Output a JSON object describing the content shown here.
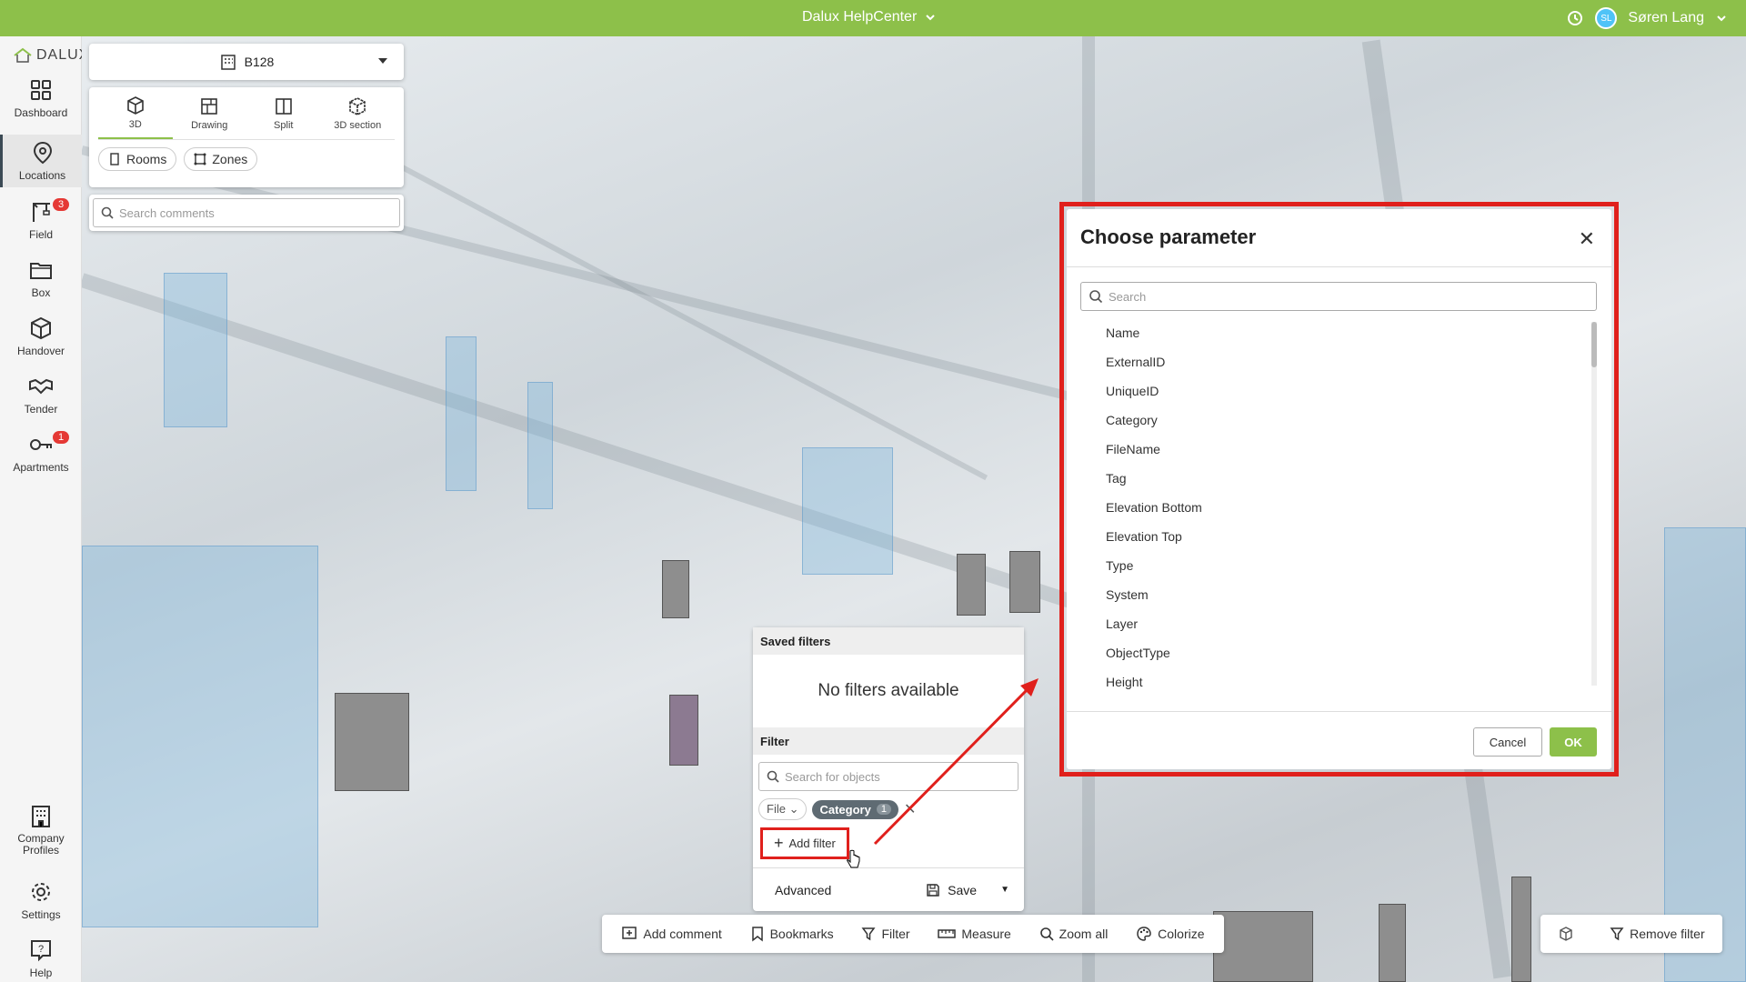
{
  "topbar": {
    "center_title": "Dalux HelpCenter",
    "user_initials": "SL",
    "user_name": "Søren Lang"
  },
  "sidebar": {
    "logo_text": "DALUX",
    "items": [
      {
        "label": "Dashboard",
        "icon": "grid-icon"
      },
      {
        "label": "Locations",
        "icon": "location-pin-icon"
      },
      {
        "label": "Field",
        "icon": "crane-icon",
        "badge": "3"
      },
      {
        "label": "Box",
        "icon": "folder-icon"
      },
      {
        "label": "Handover",
        "icon": "cube-icon"
      },
      {
        "label": "Tender",
        "icon": "handshake-icon"
      },
      {
        "label": "Apartments",
        "icon": "key-icon",
        "badge": "1"
      },
      {
        "label": "Company Profiles",
        "icon": "building-icon"
      },
      {
        "label": "Settings",
        "icon": "gear-icon"
      },
      {
        "label": "Help",
        "icon": "help-icon"
      }
    ]
  },
  "project": {
    "name": "B128"
  },
  "view_tabs": [
    {
      "label": "3D"
    },
    {
      "label": "Drawing"
    },
    {
      "label": "Split"
    },
    {
      "label": "3D section"
    }
  ],
  "chips": {
    "rooms": "Rooms",
    "zones": "Zones"
  },
  "search_comments": {
    "placeholder": "Search comments"
  },
  "filter_popup": {
    "saved_filters_title": "Saved filters",
    "empty_text": "No filters available",
    "filter_title": "Filter",
    "search_placeholder": "Search for objects",
    "file_chip": "File",
    "category_chip": "Category",
    "category_count": "1",
    "add_filter": "Add filter",
    "advanced": "Advanced",
    "save": "Save"
  },
  "toolbar": {
    "add_comment": "Add comment",
    "bookmarks": "Bookmarks",
    "filter": "Filter",
    "measure": "Measure",
    "zoom_all": "Zoom all",
    "colorize": "Colorize",
    "remove_filter": "Remove filter"
  },
  "dialog": {
    "title": "Choose parameter",
    "search_placeholder": "Search",
    "items": [
      "Name",
      "ExternalID",
      "UniqueID",
      "Category",
      "FileName",
      "Tag",
      "Elevation Bottom",
      "Elevation Top",
      "Type",
      "System",
      "Layer",
      "ObjectType",
      "Height"
    ],
    "cancel": "Cancel",
    "ok": "OK"
  },
  "colors": {
    "brand_green": "#8dc04a",
    "highlight_red": "#e0201c"
  }
}
